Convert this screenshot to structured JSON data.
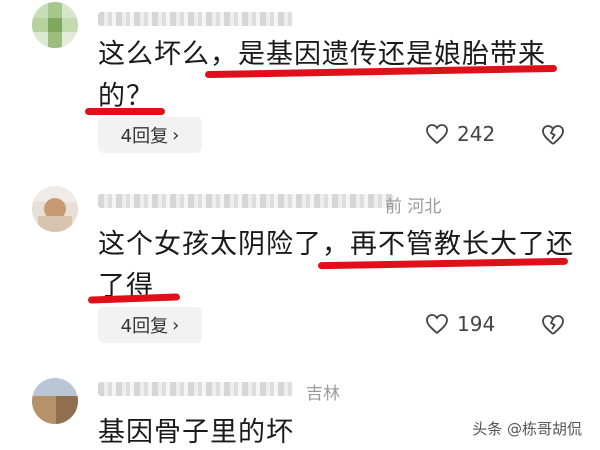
{
  "comments": [
    {
      "location": "",
      "text_line1": "这么坏么，是基因遗传还是娘胎带来",
      "text_line2": "的？",
      "reply_label": "4回复",
      "likes": "242"
    },
    {
      "location": "前 河北",
      "text_line1": "这个女孩太阴险了，再不管教长大了还",
      "text_line2": "了得",
      "reply_label": "4回复",
      "likes": "194"
    },
    {
      "location": "吉林",
      "text_line1": "基因骨子里的坏",
      "text_line2": ""
    }
  ],
  "watermark": "头条 @栋哥胡侃",
  "icons": {
    "like": "heart-outline-icon",
    "dislike": "broken-heart-icon",
    "reply_chevron": "chevron-right-icon"
  },
  "colors": {
    "annotation_red": "#e0101b",
    "reply_bg": "#f2f2f2"
  }
}
